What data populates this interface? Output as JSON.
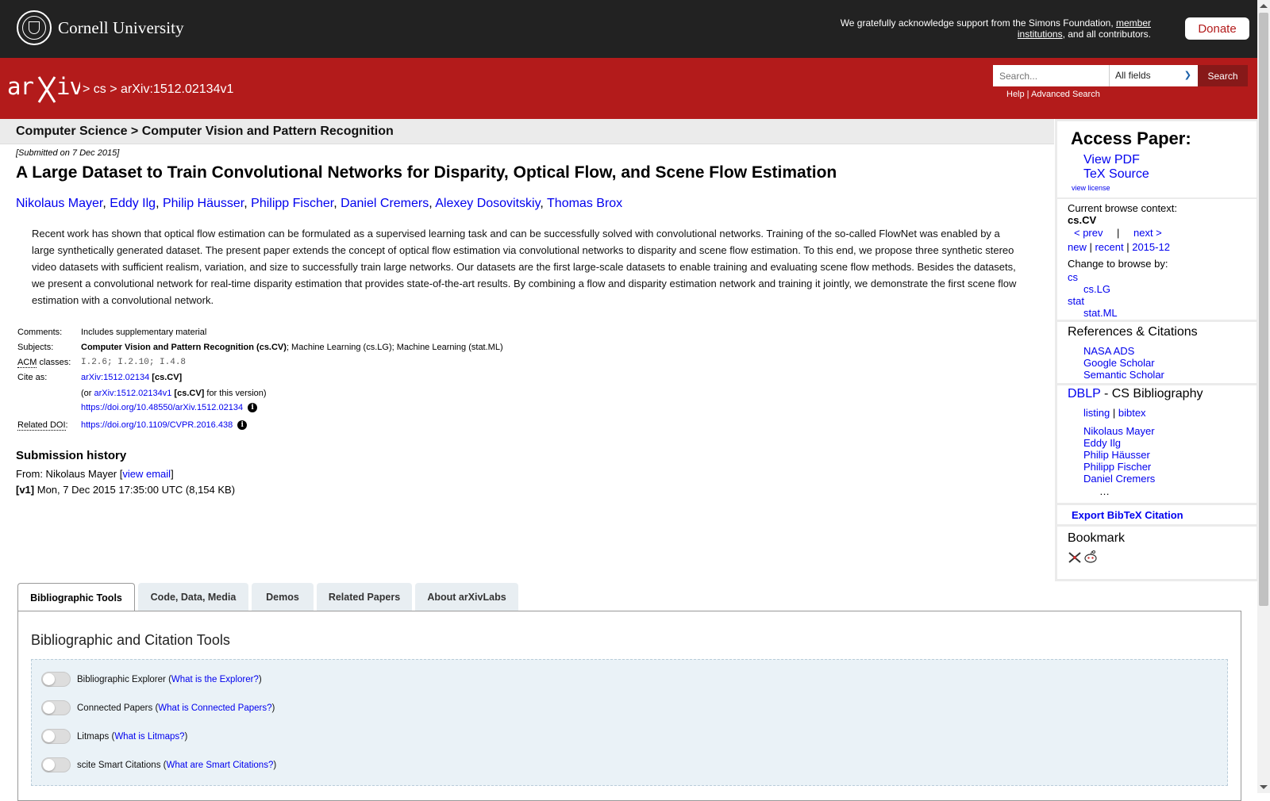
{
  "header": {
    "university": "Cornell University",
    "support_text_1": "We gratefully acknowledge support from the Simons Foundation, ",
    "support_link": "member institutions",
    "support_text_2": ", and all contributors.",
    "donate": "Donate"
  },
  "nav": {
    "logo_text": "arXiv",
    "crumb_1": "cs",
    "crumb_2": "arXiv:1512.02134v1",
    "search_placeholder": "Search...",
    "search_field": "All fields",
    "search_button": "Search",
    "help": "Help",
    "advanced_search": "Advanced Search"
  },
  "subject_header": "Computer Science > Computer Vision and Pattern Recognition",
  "paper": {
    "submitted": "[Submitted on 7 Dec 2015]",
    "title": "A Large Dataset to Train Convolutional Networks for Disparity, Optical Flow, and Scene Flow Estimation",
    "authors": [
      "Nikolaus Mayer",
      "Eddy Ilg",
      "Philip Häusser",
      "Philipp Fischer",
      "Daniel Cremers",
      "Alexey Dosovitskiy",
      "Thomas Brox"
    ],
    "abstract": "Recent work has shown that optical flow estimation can be formulated as a supervised learning task and can be successfully solved with convolutional networks. Training of the so-called FlowNet was enabled by a large synthetically generated dataset. The present paper extends the concept of optical flow estimation via convolutional networks to disparity and scene flow estimation. To this end, we propose three synthetic stereo video datasets with sufficient realism, variation, and size to successfully train large networks. Our datasets are the first large-scale datasets to enable training and evaluating scene flow methods. Besides the datasets, we present a convolutional network for real-time disparity estimation that provides state-of-the-art results. By combining a flow and disparity estimation network and training it jointly, we demonstrate the first scene flow estimation with a convolutional network."
  },
  "meta": {
    "comments_label": "Comments:",
    "comments": "Includes supplementary material",
    "subjects_label": "Subjects:",
    "subjects_primary": "Computer Vision and Pattern Recognition (cs.CV)",
    "subjects_rest": "; Machine Learning (cs.LG); Machine Learning (stat.ML)",
    "acm_label_abbr": "ACM",
    "acm_label_rest": " classes:",
    "acm": "I.2.6; I.2.10; I.4.8",
    "cite_label": "Cite as:",
    "cite_id": "arXiv:1512.02134",
    "cite_cat": " [cs.CV]",
    "cite_or": "(or ",
    "cite_version": "arXiv:1512.02134v1",
    "cite_version_cat": " [cs.CV]",
    "cite_version_tail": " for this version)",
    "doi": "https://doi.org/10.48550/arXiv.1512.02134",
    "related_doi_label": "Related DOI",
    "related_doi": "https://doi.org/10.1109/CVPR.2016.438",
    "info_glyph": "i"
  },
  "history": {
    "heading": "Submission history",
    "from_prefix": "From: Nikolaus Mayer [",
    "view_email": "view email",
    "from_suffix": "]",
    "v1_label": "[v1]",
    "v1_text": " Mon, 7 Dec 2015 17:35:00 UTC (8,154 KB)"
  },
  "sidebar": {
    "access_heading": "Access Paper:",
    "view_pdf": "View PDF",
    "tex_source": "TeX Source",
    "view_license": "view license",
    "browse_context_label": "Current browse context:",
    "browse_context": "cs.CV",
    "prev": "< prev",
    "sep": "|",
    "next": "next >",
    "new": "new",
    "recent": "recent",
    "month": "2015-12",
    "change_browse": "Change to browse by:",
    "browse_cs": "cs",
    "browse_cslg": "cs.LG",
    "browse_stat": "stat",
    "browse_statml": "stat.ML",
    "refs_heading": "References & Citations",
    "nasa": "NASA ADS",
    "scholar": "Google Scholar",
    "semantic": "Semantic Scholar",
    "dblp": "DBLP",
    "dblp_rest": " - CS Bibliography",
    "listing": "listing",
    "bibtex": "bibtex",
    "dblp_authors": [
      "Nikolaus Mayer",
      "Eddy Ilg",
      "Philip Häusser",
      "Philipp Fischer",
      "Daniel Cremers"
    ],
    "ellipsis": "…",
    "export_bibtex": "Export BibTeX Citation",
    "bookmark": "Bookmark"
  },
  "tabs": [
    "Bibliographic Tools",
    "Code, Data, Media",
    "Demos",
    "Related Papers",
    "About arXivLabs"
  ],
  "tools": {
    "heading": "Bibliographic and Citation Tools",
    "items": [
      {
        "name": "Bibliographic Explorer",
        "link": "What is the Explorer?"
      },
      {
        "name": "Connected Papers",
        "link": "What is Connected Papers?"
      },
      {
        "name": "Litmaps",
        "link": "What is Litmaps?"
      },
      {
        "name": "scite Smart Citations",
        "link": "What are Smart Citations?"
      }
    ]
  }
}
